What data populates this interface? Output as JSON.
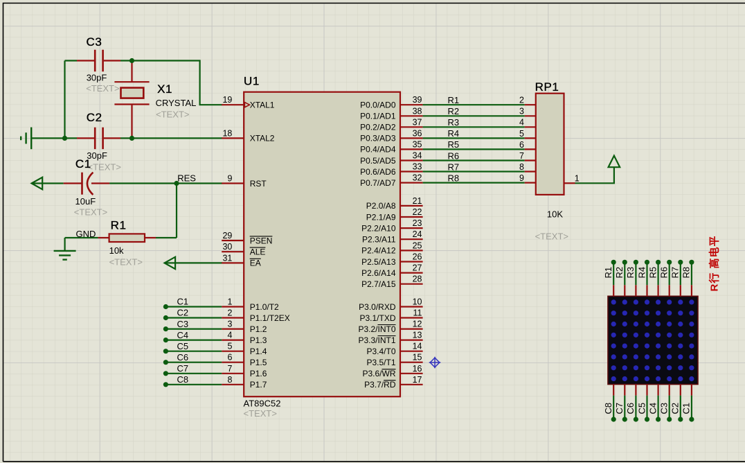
{
  "colors": {
    "sheet_bg": "#e4e4d7",
    "outside_bg": "#e0e0d3",
    "grid_minor": "#d0d0c3",
    "grid_major": "#c6c6c3",
    "sheet_border": "#000000",
    "wire_green": "#0c5c10",
    "component_red": "#960e0e",
    "body_fill": "#d2d2bd",
    "text_black": "#000000",
    "text_grey": "#a0a098",
    "annotation_red": "#c00606",
    "matrix_bg": "#0a0a13",
    "matrix_dot": "#2727b4",
    "origin_blue": "#3434bE"
  },
  "u1": {
    "ref": "U1",
    "part": "AT89C52",
    "text": "<TEXT>",
    "left_pins": [
      {
        "num": "19",
        "name": "XTAL1",
        "clock": true
      },
      {
        "num": "18",
        "name": "XTAL2"
      },
      {
        "num": "9",
        "name": "RST"
      },
      {
        "num": "29",
        "name": "PSEN",
        "bar": "PSEN"
      },
      {
        "num": "30",
        "name": "ALE",
        "bar": "ALE"
      },
      {
        "num": "31",
        "name": "EA",
        "bar": "EA"
      },
      {
        "num": "1",
        "name": "P1.0/T2"
      },
      {
        "num": "2",
        "name": "P1.1/T2EX"
      },
      {
        "num": "3",
        "name": "P1.2"
      },
      {
        "num": "4",
        "name": "P1.3"
      },
      {
        "num": "5",
        "name": "P1.4"
      },
      {
        "num": "6",
        "name": "P1.5"
      },
      {
        "num": "7",
        "name": "P1.6"
      },
      {
        "num": "8",
        "name": "P1.7"
      }
    ],
    "right_pins": [
      {
        "num": "39",
        "name": "P0.0/AD0"
      },
      {
        "num": "38",
        "name": "P0.1/AD1"
      },
      {
        "num": "37",
        "name": "P0.2/AD2"
      },
      {
        "num": "36",
        "name": "P0.3/AD3"
      },
      {
        "num": "35",
        "name": "P0.4/AD4"
      },
      {
        "num": "34",
        "name": "P0.5/AD5"
      },
      {
        "num": "33",
        "name": "P0.6/AD6"
      },
      {
        "num": "32",
        "name": "P0.7/AD7"
      },
      {
        "num": "21",
        "name": "P2.0/A8"
      },
      {
        "num": "22",
        "name": "P2.1/A9"
      },
      {
        "num": "23",
        "name": "P2.2/A10"
      },
      {
        "num": "24",
        "name": "P2.3/A11"
      },
      {
        "num": "25",
        "name": "P2.4/A12"
      },
      {
        "num": "26",
        "name": "P2.5/A13"
      },
      {
        "num": "27",
        "name": "P2.6/A14"
      },
      {
        "num": "28",
        "name": "P2.7/A15"
      },
      {
        "num": "10",
        "name": "P3.0/RXD"
      },
      {
        "num": "11",
        "name": "P3.1/TXD"
      },
      {
        "num": "12",
        "name": "P3.2/INT0",
        "bar": "INT0"
      },
      {
        "num": "13",
        "name": "P3.3/INT1",
        "bar": "INT1"
      },
      {
        "num": "14",
        "name": "P3.4/T0"
      },
      {
        "num": "15",
        "name": "P3.5/T1"
      },
      {
        "num": "16",
        "name": "P3.6/WR",
        "bar": "WR"
      },
      {
        "num": "17",
        "name": "P3.7/RD",
        "bar": "RD"
      }
    ]
  },
  "c3": {
    "ref": "C3",
    "value": "30pF",
    "text": "<TEXT>"
  },
  "c2": {
    "ref": "C2",
    "value": "30pF",
    "text": "<TEXT>"
  },
  "c1": {
    "ref": "C1",
    "value": "10uF",
    "text": "<TEXT>"
  },
  "x1": {
    "ref": "X1",
    "value": "CRYSTAL",
    "text": "<TEXT>"
  },
  "r1": {
    "ref": "R1",
    "value": "10k",
    "text": "<TEXT>"
  },
  "rp1": {
    "ref": "RP1",
    "value": "10K",
    "text": "<TEXT>",
    "left_pin_nums": [
      "2",
      "3",
      "4",
      "5",
      "6",
      "7",
      "8",
      "9"
    ],
    "right_pin_num": "1"
  },
  "net_labels": {
    "res": "RES",
    "gnd": "GND",
    "p1_wires": [
      "C1",
      "C2",
      "C3",
      "C4",
      "C5",
      "C6",
      "C7",
      "C8"
    ],
    "p0_wires": [
      "R1",
      "R2",
      "R3",
      "R4",
      "R5",
      "R6",
      "R7",
      "R8"
    ]
  },
  "matrix": {
    "rows": 8,
    "cols": 8,
    "top_labels": [
      "R1",
      "R2",
      "R3",
      "R4",
      "R5",
      "R6",
      "R7",
      "R8"
    ],
    "bottom_labels": [
      "C8",
      "C7",
      "C6",
      "C5",
      "C4",
      "C3",
      "C2",
      "C1"
    ]
  },
  "annotation": {
    "text": "R行 高电平"
  }
}
